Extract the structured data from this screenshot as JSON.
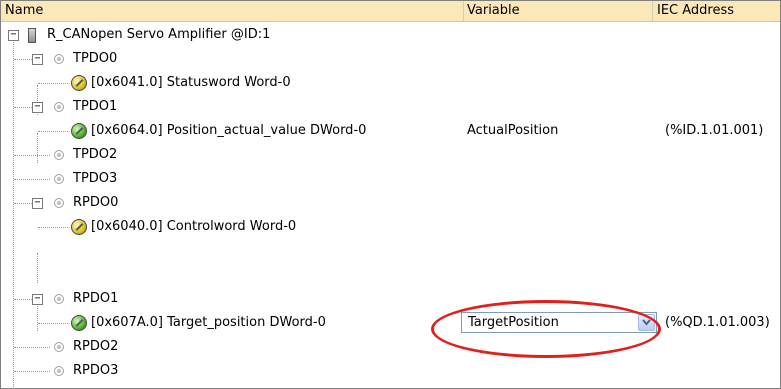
{
  "columns": {
    "name": "Name",
    "variable": "Variable",
    "iec_address": "IEC Address"
  },
  "tree": {
    "device": "R_CANopen Servo Amplifier @ID:1",
    "tpdo0": {
      "label": "TPDO0",
      "entry": "[0x6041.0] Statusword Word-0"
    },
    "tpdo1": {
      "label": "TPDO1",
      "entry": "[0x6064.0] Position_actual_value DWord-0",
      "variable": "ActualPosition",
      "address": "(%ID.1.01.001)"
    },
    "tpdo2": {
      "label": "TPDO2"
    },
    "tpdo3": {
      "label": "TPDO3"
    },
    "rpdo0": {
      "label": "RPDO0",
      "entry": "[0x6040.0] Controlword Word-0"
    },
    "rpdo1": {
      "label": "RPDO1",
      "entry": "[0x607A.0] Target_position DWord-0",
      "variable": "TargetPosition",
      "address": "(%QD.1.01.003)"
    },
    "rpdo2": {
      "label": "RPDO2"
    },
    "rpdo3": {
      "label": "RPDO3"
    }
  },
  "expander_symbol": "−",
  "icons": {
    "device": "device-module-icon",
    "pdo": "pdo-node-icon",
    "variable_unmapped": "variable-yellow-icon",
    "variable_mapped": "variable-green-icon",
    "dropdown": "chevron-down-icon"
  },
  "colors": {
    "header_bg": "#fbe8b8",
    "highlight": "#e0201c",
    "combo_border": "#7f9db9"
  }
}
